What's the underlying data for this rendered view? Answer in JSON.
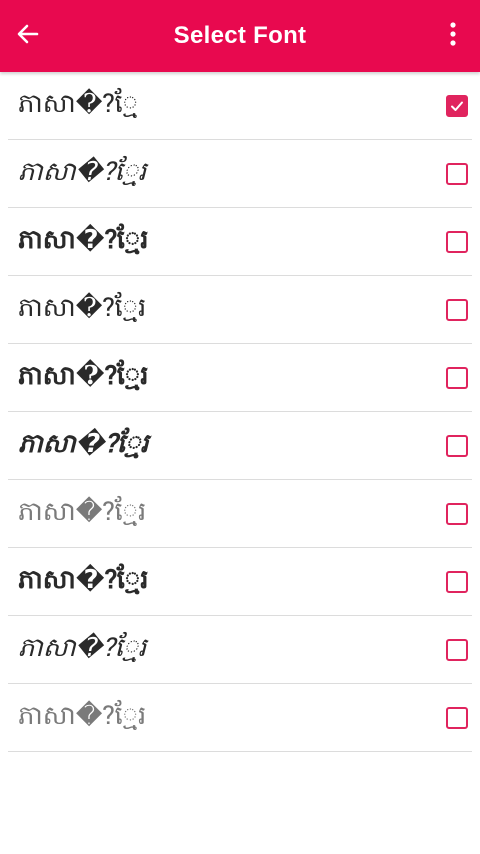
{
  "header": {
    "title": "Select Font",
    "back_icon": "arrow-left-icon",
    "menu_icon": "more-vertical-icon",
    "color": "#e8094f"
  },
  "accent_color": "#e0245e",
  "fonts": [
    {
      "label": "ភាសា�?ែ្ម",
      "checked": true
    },
    {
      "label": "ភាសា�?្មែរ",
      "checked": false
    },
    {
      "label": "ភាសា�?្មែរ",
      "checked": false
    },
    {
      "label": "ភាសា�?្មែរ",
      "checked": false
    },
    {
      "label": "ភាសា�?្មែរ",
      "checked": false
    },
    {
      "label": "ភាសា�?្មែរ",
      "checked": false
    },
    {
      "label": "ភាសា�?្មែរ",
      "checked": false
    },
    {
      "label": "ភាសា�?្មែរ",
      "checked": false
    },
    {
      "label": "ភាសា�?្មែរ",
      "checked": false
    },
    {
      "label": "ភាសា�?្មែរ",
      "checked": false
    }
  ]
}
